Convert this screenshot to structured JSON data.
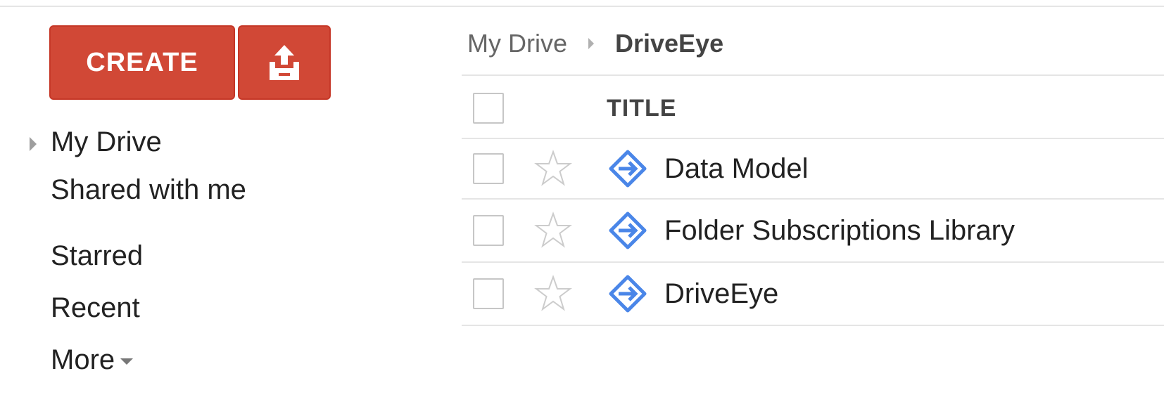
{
  "sidebar": {
    "create_label": "CREATE",
    "upload_icon": "upload-icon",
    "nav": {
      "my_drive": "My Drive",
      "shared_with_me": "Shared with me",
      "starred": "Starred",
      "recent": "Recent",
      "more": "More"
    }
  },
  "breadcrumb": {
    "root": "My Drive",
    "current": "DriveEye"
  },
  "file_list": {
    "header_title": "TITLE",
    "rows": [
      {
        "title": "Data Model",
        "starred": false,
        "icon": "apps-script-icon"
      },
      {
        "title": "Folder Subscriptions Library",
        "starred": false,
        "icon": "apps-script-icon"
      },
      {
        "title": "DriveEye",
        "starred": false,
        "icon": "apps-script-icon"
      }
    ]
  },
  "colors": {
    "create_red": "#d14836",
    "script_blue": "#4a86e8",
    "star_grey": "#cccccc"
  }
}
